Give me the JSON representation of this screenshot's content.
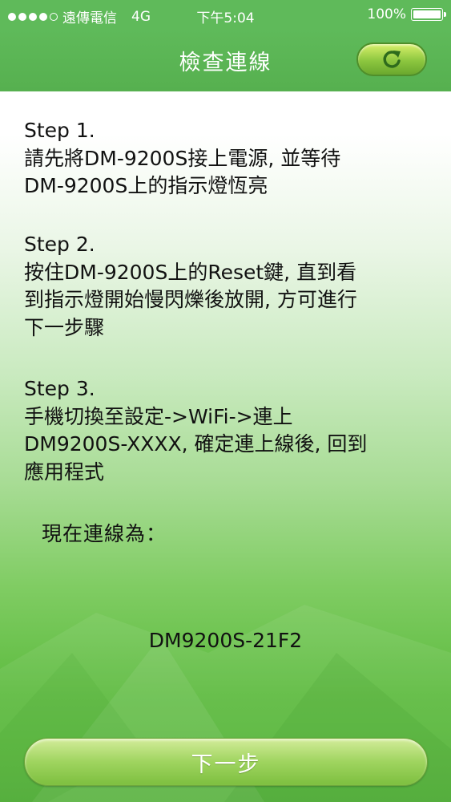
{
  "status_bar": {
    "carrier": "遠傳電信",
    "network": "4G",
    "time": "下午5:04",
    "battery_percent": "100%",
    "battery_level": 1.0,
    "signal_bars_filled": 4,
    "signal_bars_total": 5
  },
  "nav": {
    "title": "檢查連線",
    "refresh_icon": "refresh-icon"
  },
  "steps": [
    {
      "title": "Step 1.",
      "lines": [
        "請先將DM-9200S接上電源, 並等待",
        "DM-9200S上的指示燈恆亮"
      ]
    },
    {
      "title": "Step 2.",
      "lines": [
        "按住DM-9200S上的Reset鍵, 直到看",
        "到指示燈開始慢閃爍後放開, 方可進行",
        "下一步驟"
      ]
    },
    {
      "title": "Step 3.",
      "lines": [
        "手機切換至設定->WiFi->連上",
        "DM9200S-XXXX, 確定連上線後, 回到",
        "應用程式"
      ]
    }
  ],
  "connection": {
    "label": "現在連線為：",
    "value": "DM9200S-21F2"
  },
  "next_button_label": "下一步",
  "colors": {
    "header_green": "#5fba5a",
    "button_green": "#9fd45f",
    "text": "#111111"
  }
}
